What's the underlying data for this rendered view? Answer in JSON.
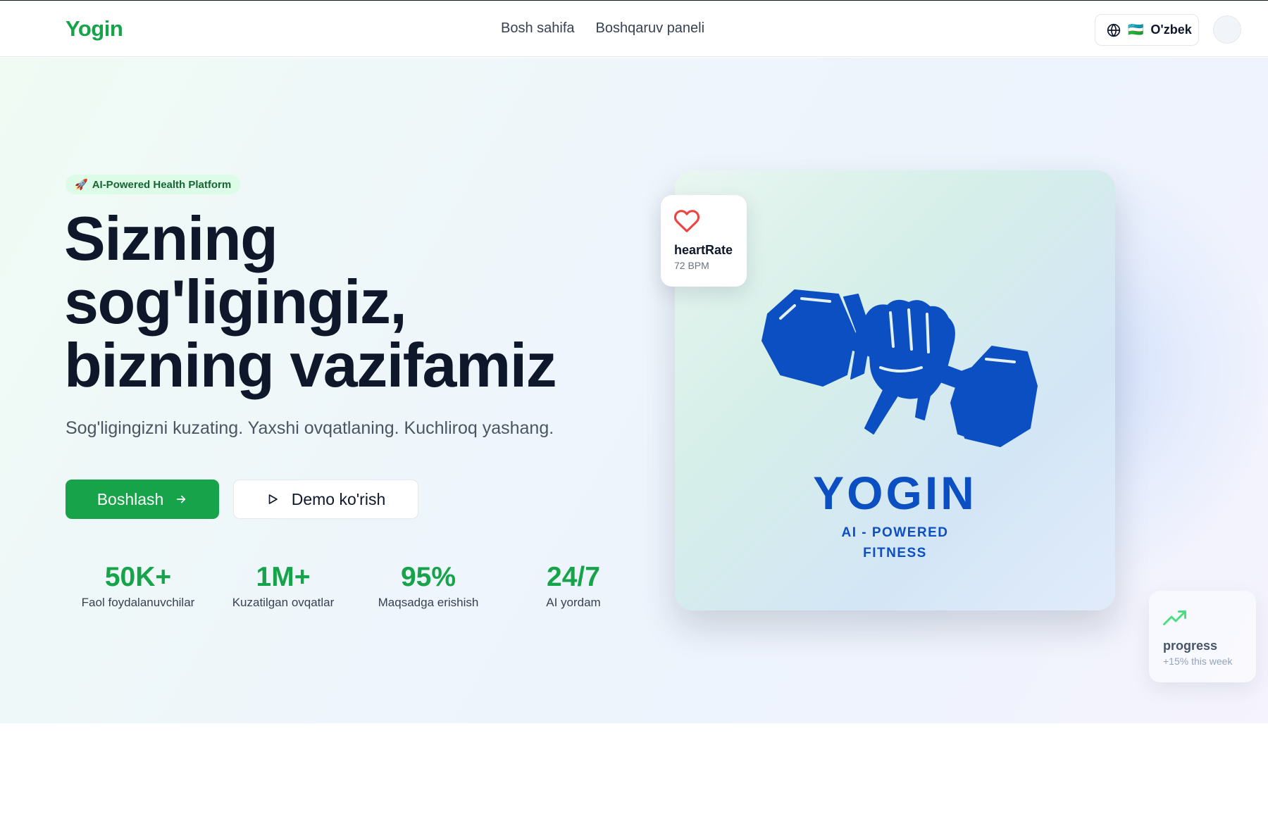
{
  "header": {
    "logo": "Yogin",
    "nav": [
      {
        "label": "Bosh sahifa"
      },
      {
        "label": "Boshqaruv paneli"
      }
    ],
    "language": {
      "flag": "🇺🇿",
      "label": "O'zbek",
      "icon": "globe-icon"
    }
  },
  "hero": {
    "badge": {
      "emoji": "🚀",
      "label": "AI-Powered Health Platform"
    },
    "title_lines": [
      "Sizning",
      "sog'ligingiz,",
      "bizning vazifamiz"
    ],
    "subtitle": "Sog'ligingizni kuzating. Yaxshi ovqatlaning. Kuchliroq yashang.",
    "primary_button": {
      "label": "Boshlash",
      "icon": "arrow-right-icon"
    },
    "secondary_button": {
      "label": "Demo ko'rish",
      "icon": "play-icon"
    },
    "stats": [
      {
        "value": "50K+",
        "label": "Faol foydalanuvchilar"
      },
      {
        "value": "1M+",
        "label": "Kuzatilgan ovqatlar"
      },
      {
        "value": "95%",
        "label": "Maqsadga erishish"
      },
      {
        "value": "24/7",
        "label": "AI yordam"
      }
    ]
  },
  "visual": {
    "brand_name": "YOGIN",
    "brand_tag_lines": [
      "AI - POWERED",
      "FITNESS"
    ],
    "heart_card": {
      "label": "heartRate",
      "value": "72 BPM",
      "icon": "heart-icon"
    },
    "progress_card": {
      "label": "progress",
      "value": "+15% this week",
      "icon": "trending-up-icon"
    }
  },
  "colors": {
    "accent": "#16a34a",
    "brand_blue": "#0b4fc2",
    "heart": "#ef4444",
    "text_dark": "#0f172a"
  }
}
